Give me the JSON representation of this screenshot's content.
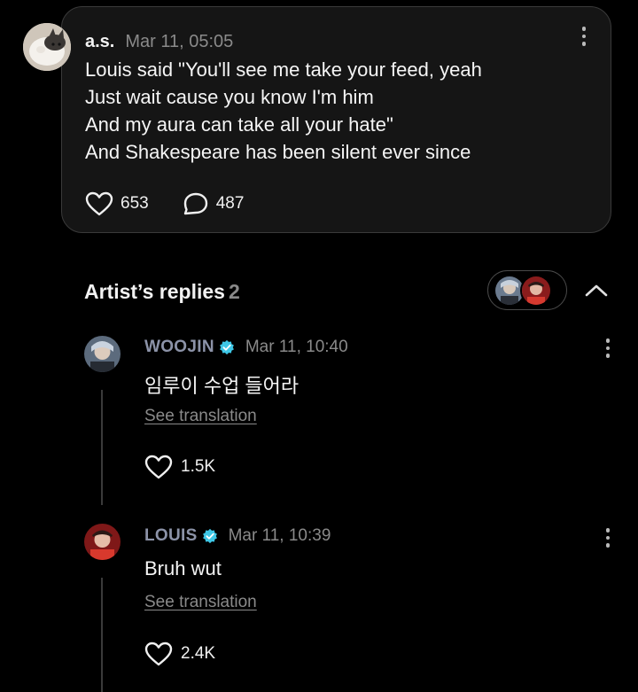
{
  "post": {
    "author": "a.s.",
    "timestamp": "Mar 11, 05:05",
    "lines": [
      "Louis said \"You'll see me take your feed, yeah",
      "Just wait cause you know I'm him",
      "And my aura can take all your hate\"",
      "And Shakespeare has been silent ever since"
    ],
    "likes": "653",
    "comments": "487"
  },
  "artist_replies": {
    "title": "Artist’s replies",
    "count": "2"
  },
  "replies": [
    {
      "name": "WOOJIN",
      "timestamp": "Mar 11, 10:40",
      "text": "임루이 수업 들어라",
      "translate_label": "See translation",
      "likes": "1.5K"
    },
    {
      "name": "LOUIS",
      "timestamp": "Mar 11, 10:39",
      "text": "Bruh wut",
      "translate_label": "See translation",
      "likes": "2.4K"
    }
  ],
  "colors": {
    "background": "#000000",
    "card": "#151515",
    "verified": "#3ec7e6",
    "muted": "#8a8a8a",
    "artist_name": "#8c93a8"
  },
  "icons": [
    "more-vertical-icon",
    "heart-icon",
    "comment-icon",
    "chevron-up-icon",
    "verified-badge-icon"
  ]
}
